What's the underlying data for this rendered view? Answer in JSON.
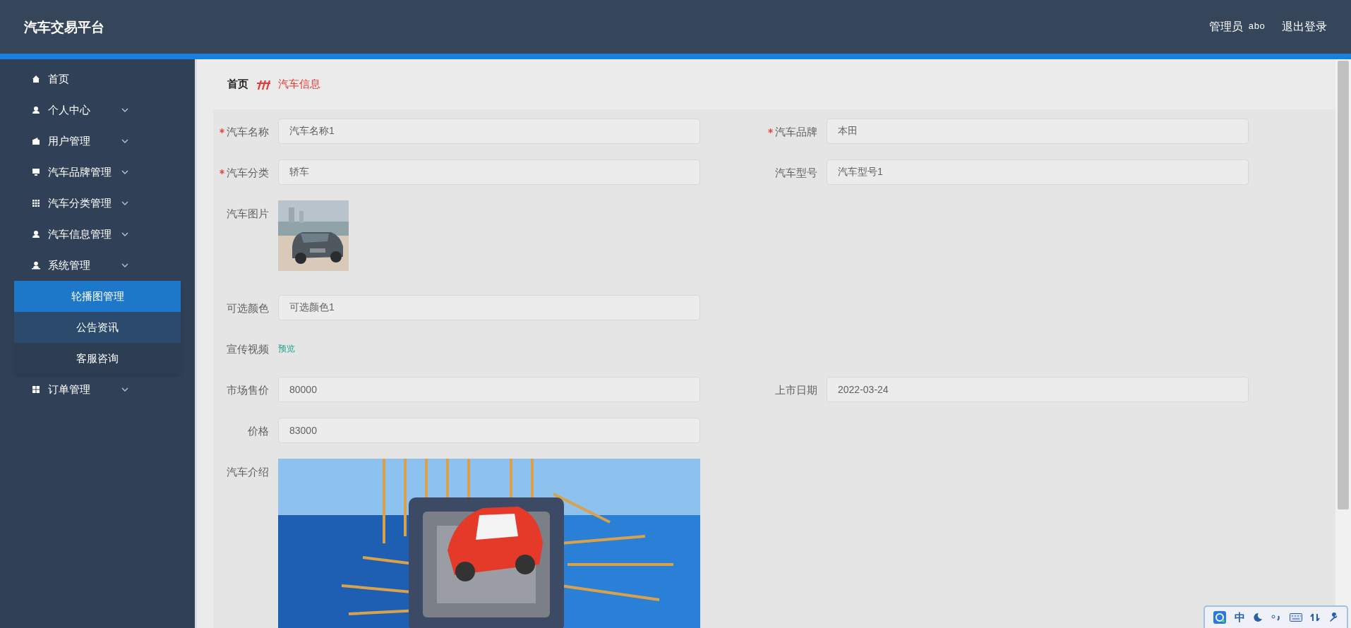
{
  "header": {
    "title": "汽车交易平台",
    "role": "管理员",
    "username": "abo",
    "logout": "退出登录"
  },
  "sidebar": {
    "items": [
      {
        "kind": "link",
        "label": "首页"
      },
      {
        "kind": "menu",
        "label": "个人中心"
      },
      {
        "kind": "menu",
        "label": "用户管理"
      },
      {
        "kind": "menu",
        "label": "汽车品牌管理"
      },
      {
        "kind": "menu",
        "label": "汽车分类管理"
      },
      {
        "kind": "menu",
        "label": "汽车信息管理"
      },
      {
        "kind": "menu",
        "label": "系统管理",
        "expanded": true,
        "children": [
          {
            "label": "轮播图管理",
            "selected": true,
            "hovered": false
          },
          {
            "label": "公告资讯",
            "selected": false,
            "hovered": true
          },
          {
            "label": "客服咨询",
            "selected": false,
            "hovered": false
          }
        ]
      },
      {
        "kind": "menu",
        "label": "订单管理"
      }
    ]
  },
  "breadcrumb": [
    {
      "label": "首页",
      "current": false
    },
    {
      "label": "汽车信息",
      "current": true
    }
  ],
  "form": {
    "rows": [
      [
        {
          "kind": "text",
          "label": "汽车名称",
          "required": true,
          "value": "汽车名称1"
        },
        {
          "kind": "text",
          "label": "汽车品牌",
          "required": true,
          "value": "本田"
        }
      ],
      [
        {
          "kind": "text",
          "label": "汽车分类",
          "required": true,
          "value": "轿车"
        },
        {
          "kind": "text",
          "label": "汽车型号",
          "required": false,
          "value": "汽车型号1"
        }
      ],
      [
        {
          "label": "汽车图片",
          "required": false
        }
      ],
      [
        {
          "kind": "text",
          "label": "可选颜色",
          "required": false,
          "value": "可选颜色1"
        }
      ],
      [
        {
          "kind": "video",
          "label": "宣传视频",
          "required": false,
          "link": "预览"
        }
      ],
      [
        {
          "kind": "text",
          "label": "市场售价",
          "required": false,
          "value": "80000"
        },
        {
          "kind": "text",
          "label": "上市日期",
          "required": false,
          "value": "2022-03-24"
        }
      ],
      [
        {
          "kind": "text",
          "label": "价格",
          "required": false,
          "value": "83000"
        }
      ],
      [
        {
          "kind": "rich",
          "label": "汽车介绍",
          "required": false
        }
      ]
    ]
  },
  "ime": {
    "mode": "中"
  }
}
